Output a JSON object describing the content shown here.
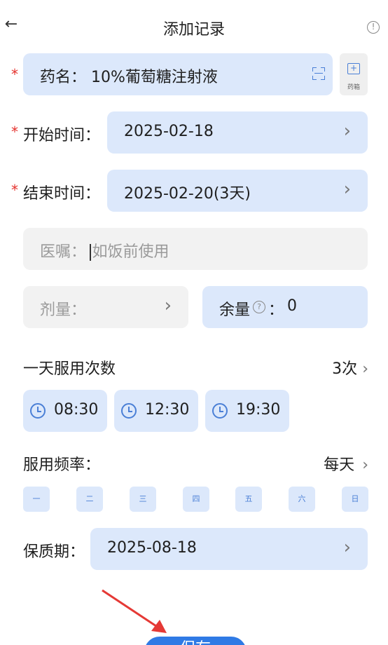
{
  "header": {
    "back_icon": "back-arrow-icon",
    "title": "添加记录",
    "info_icon": "info-icon"
  },
  "medicine": {
    "required": "*",
    "label": "药名：",
    "value": "10%葡萄糖注射液",
    "scan_icon": "scan-icon",
    "kit_label": "药箱"
  },
  "start": {
    "required": "*",
    "label": "开始时间：",
    "value": "2025-02-18"
  },
  "end": {
    "required": "*",
    "label": "结束时间：",
    "value": "2025-02-20(3天)"
  },
  "advice": {
    "label": "医嘱：",
    "placeholder": "如饭前使用"
  },
  "dose": {
    "label": "剂量："
  },
  "remain": {
    "label": "余量",
    "colon": "：",
    "value": "0",
    "help_icon": "help-icon"
  },
  "times": {
    "label": "一天服用次数",
    "count": "3次",
    "items": [
      "08:30",
      "12:30",
      "19:30"
    ]
  },
  "frequency": {
    "label": "服用频率：",
    "value": "每天",
    "days": [
      "一",
      "二",
      "三",
      "四",
      "五",
      "六",
      "日"
    ]
  },
  "shelf": {
    "label": "保质期：",
    "value": "2025-08-18"
  },
  "save_label": "保存",
  "colors": {
    "accent": "#2f7ae5",
    "field": "#dce8fb",
    "required": "#e5322d",
    "annotation_arrow": "#e53935"
  }
}
